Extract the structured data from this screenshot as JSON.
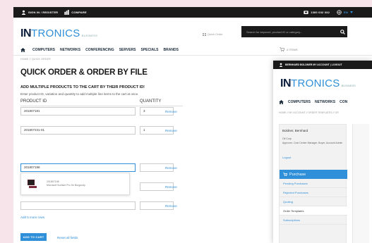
{
  "main": {
    "topbar": {
      "sign_in": "SIGN IN / REGISTER",
      "compare": "COMPARE",
      "phone": "1300 032 032",
      "lang": "EN"
    },
    "logo": {
      "part1": "IN",
      "part2": "TRONICS",
      "part3": "BUSINESS"
    },
    "quick_order": "Quick Order",
    "search_placeholder": "Search for keyword, product ID or category...",
    "nav": [
      "COMPUTERS",
      "NETWORKS",
      "CONFERENCING",
      "SERVERS",
      "SPECIALS",
      "BRANDS"
    ],
    "cart_label": "0 ITEMS",
    "breadcrumb": "HOME // QUICK ORDER",
    "title": "QUICK ORDER & ORDER BY FILE",
    "subtitle": "ADD MULTIPLE PRODUCTS TO THE CART BY THEIR PRODUCT ID!",
    "description": "Enter product ID, variation and quantity to add multiple line items to the cart at once.",
    "col_product": "PRODUCT ID",
    "col_quantity": "QUANTITY",
    "rows": [
      {
        "product": "201807181",
        "qty": "3",
        "remove": "Remove"
      },
      {
        "product": "201807231-01",
        "qty": "1",
        "remove": "Remove"
      },
      {
        "product": "201807198",
        "qty": "",
        "remove": "Remove"
      },
      {
        "product": "",
        "qty": "",
        "remove": "Remove"
      },
      {
        "product": "",
        "qty": "",
        "remove": "Remove"
      }
    ],
    "suggestion": {
      "id": "201807198",
      "name": "Microsoft Surface Pro Se Burgundy"
    },
    "add_rows": "Add 5 more rows",
    "add_to_cart": "ADD TO CART",
    "reset": "Reset all fields"
  },
  "second": {
    "topbar": "BERNHARD BOLDNER  MY ACCOUNT  |  LOGOUT",
    "logo": {
      "part1": "IN",
      "part2": "TRONICS",
      "part3": "BUSINESS"
    },
    "nav": [
      "COMPUTERS",
      "NETWORKS",
      "CON"
    ],
    "breadcrumb": "HOME // MY ACCOUNT // ORDER TEMPLATES // OR",
    "user_name": "Boldner, Bernhard",
    "user_info": "Oil Corp\nApprover, Cost Center Manager, Buyer, Account Admin",
    "logout": "Logout",
    "section": "Purchase",
    "items": [
      "Pending Purchases",
      "Rejected Purchases",
      "Quoting",
      "Order Templates",
      "Subscriptions"
    ],
    "active_item": "Order Templates"
  },
  "colors": {
    "accent": "#2f8fd8",
    "dark": "#1a1a1a",
    "navy": "#0a1e3c",
    "background": "#f7e3ea"
  }
}
